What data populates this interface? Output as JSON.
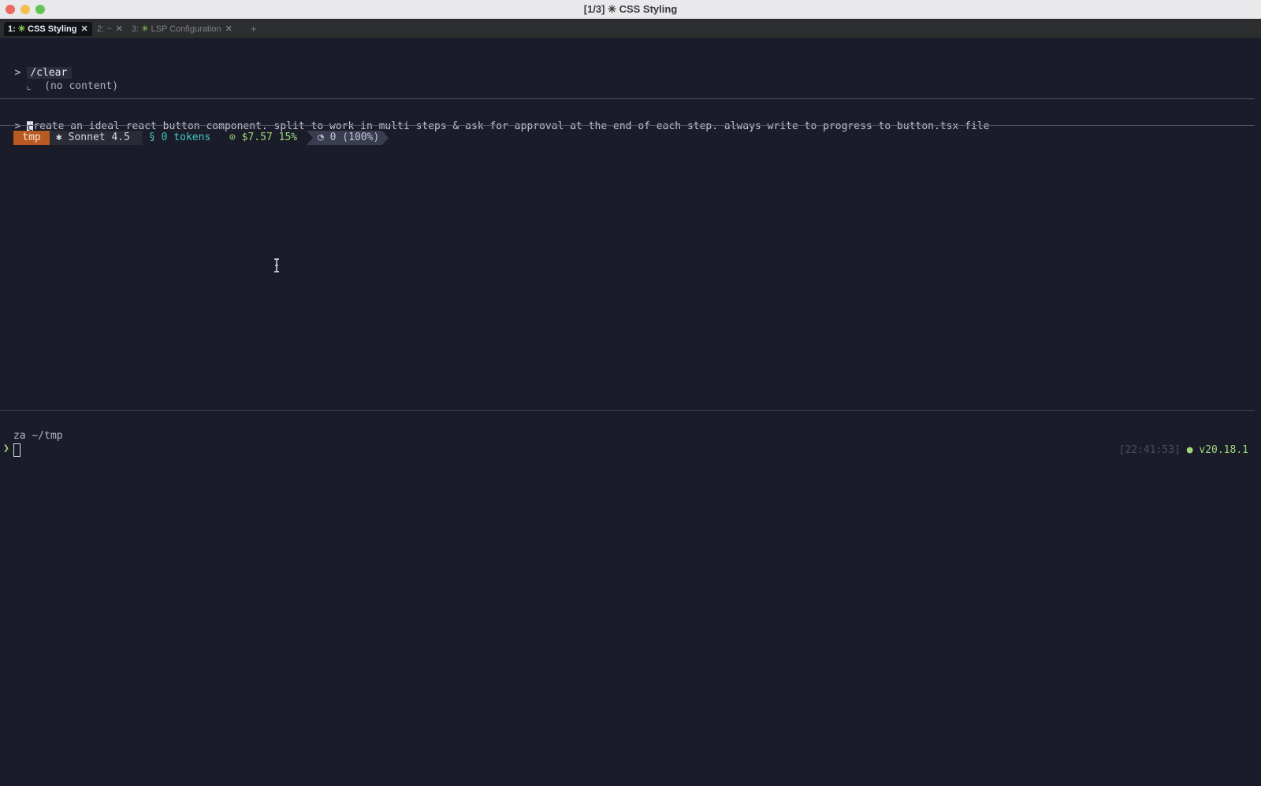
{
  "window": {
    "title": "[1/3] ✳ CSS Styling"
  },
  "tabs": [
    {
      "label": "1: ",
      "icon": "✳",
      "name": "CSS Styling",
      "close": "✕"
    },
    {
      "label": "2: ~",
      "close": "✕"
    },
    {
      "label": "3: ",
      "icon": "✳",
      "name": "LSP Configuration",
      "close": "✕"
    }
  ],
  "tab_add": "+",
  "session": {
    "prompt_marker": ">",
    "clear_command": "/clear",
    "clear_tree": "⌞",
    "clear_result": "(no content)",
    "input_first_char": "c",
    "input_rest": "reate an ideal react button component. split to work in multi steps & ask for approval at the end of each step. always write to progress to button.tsx file"
  },
  "statusline": {
    "dir": "tmp",
    "model": "✱ Sonnet 4.5",
    "tokens": "§ 0 tokens",
    "cost": "⊙ $7.57 15%",
    "context": "◔ 0 (100%)"
  },
  "shell": {
    "cwd": "za ~/tmp",
    "prompt_glyph": "❯",
    "time": "[22:41:53]",
    "node_dot": "●",
    "node_version": "v20.18.1"
  },
  "colors": {
    "background": "#1b1c2a",
    "dir_segment": "#b85a22",
    "tokens": "#43c8c4",
    "cost": "#9fd77a",
    "spark": "#8fd14f"
  }
}
